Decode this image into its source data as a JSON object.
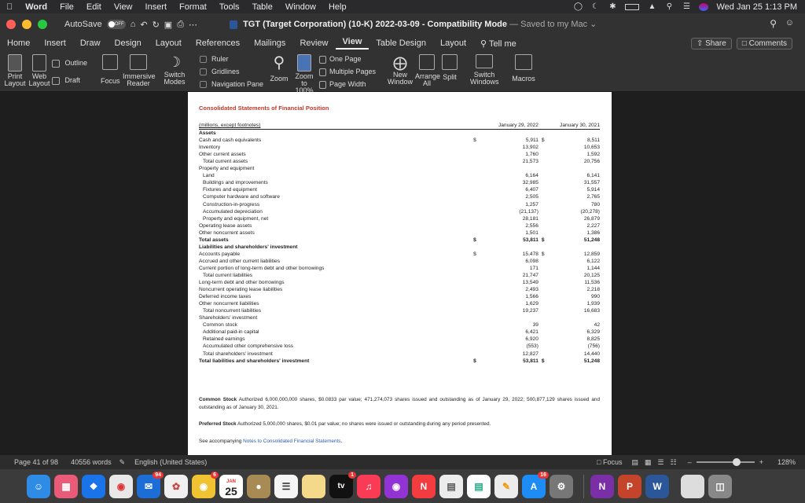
{
  "menubar": {
    "apple_icon": "apple-icon",
    "items": [
      "Word",
      "File",
      "Edit",
      "View",
      "Insert",
      "Format",
      "Tools",
      "Table",
      "Window",
      "Help"
    ],
    "datetime": "Wed Jan 25  1:13 PM"
  },
  "titlebar": {
    "autosave_label": "AutoSave",
    "autosave_state": "OFF",
    "doc_title": "TGT (Target Corporation) (10-K) 2022-03-09  -  Compatibility Mode",
    "saved_status": "— Saved to my Mac ⌄"
  },
  "tabs": {
    "items": [
      "Home",
      "Insert",
      "Draw",
      "Design",
      "Layout",
      "References",
      "Mailings",
      "Review",
      "View",
      "Table Design",
      "Layout"
    ],
    "active": "View",
    "tell_me": "Tell me",
    "share": "Share",
    "comments": "Comments"
  },
  "ribbon": {
    "print_layout": "Print\nLayout",
    "web_layout": "Web\nLayout",
    "outline": "Outline",
    "draft": "Draft",
    "focus": "Focus",
    "immersive_reader": "Immersive\nReader",
    "switch_modes": "Switch\nModes",
    "ruler": "Ruler",
    "gridlines": "Gridlines",
    "navigation_pane": "Navigation Pane",
    "zoom": "Zoom",
    "zoom_100": "Zoom\nto 100%",
    "one_page": "One Page",
    "multiple_pages": "Multiple Pages",
    "page_width": "Page Width",
    "new_window": "New\nWindow",
    "arrange_all": "Arrange\nAll",
    "split": "Split",
    "switch_windows": "Switch\nWindows",
    "macros": "Macros"
  },
  "document": {
    "heading": "Consolidated Statements of Financial Position",
    "col_header_label": "(millions, except footnotes)",
    "col1": "January 29, 2022",
    "col2": "January 30, 2021",
    "rows": [
      {
        "label": "Assets",
        "style": "bold"
      },
      {
        "label": "Cash and cash equivalents",
        "c1": "$",
        "v1": "5,911",
        "c2": "$",
        "v2": "8,511"
      },
      {
        "label": "Inventory",
        "v1": "13,902",
        "v2": "10,653"
      },
      {
        "label": "Other current assets",
        "v1": "1,760",
        "v2": "1,592"
      },
      {
        "label": "Total current assets",
        "v1": "21,573",
        "v2": "20,756",
        "style": "indent"
      },
      {
        "label": "Property and equipment"
      },
      {
        "label": "Land",
        "v1": "6,164",
        "v2": "6,141",
        "style": "indent"
      },
      {
        "label": "Buildings and improvements",
        "v1": "32,985",
        "v2": "31,557",
        "style": "indent"
      },
      {
        "label": "Fixtures and equipment",
        "v1": "6,407",
        "v2": "5,914",
        "style": "indent"
      },
      {
        "label": "Computer hardware and software",
        "v1": "2,505",
        "v2": "2,765",
        "style": "indent"
      },
      {
        "label": "Construction-in-progress",
        "v1": "1,257",
        "v2": "780",
        "style": "indent"
      },
      {
        "label": "Accumulated depreciation",
        "v1": "(21,137)",
        "v2": "(20,278)",
        "style": "indent"
      },
      {
        "label": "Property and equipment, net",
        "v1": "28,181",
        "v2": "26,879",
        "style": "indent"
      },
      {
        "label": "Operating lease assets",
        "v1": "2,556",
        "v2": "2,227"
      },
      {
        "label": "Other noncurrent assets",
        "v1": "1,501",
        "v2": "1,386"
      },
      {
        "label": "Total assets",
        "c1": "$",
        "v1": "53,811",
        "c2": "$",
        "v2": "51,248",
        "style": "bold"
      },
      {
        "label": "Liabilities and shareholders' investment",
        "style": "bold"
      },
      {
        "label": "Accounts payable",
        "c1": "$",
        "v1": "15,478",
        "c2": "$",
        "v2": "12,859"
      },
      {
        "label": "Accrued and other current liabilities",
        "v1": "6,098",
        "v2": "6,122"
      },
      {
        "label": "Current portion of long-term debt and other borrowings",
        "v1": "171",
        "v2": "1,144"
      },
      {
        "label": "Total current liabilities",
        "v1": "21,747",
        "v2": "20,125",
        "style": "indent"
      },
      {
        "label": "Long-term debt and other borrowings",
        "v1": "13,549",
        "v2": "11,536"
      },
      {
        "label": "Noncurrent operating lease liabilities",
        "v1": "2,493",
        "v2": "2,218"
      },
      {
        "label": "Deferred income taxes",
        "v1": "1,566",
        "v2": "990"
      },
      {
        "label": "Other noncurrent liabilities",
        "v1": "1,629",
        "v2": "1,939"
      },
      {
        "label": "Total noncurrent liabilities",
        "v1": "19,237",
        "v2": "16,683",
        "style": "indent"
      },
      {
        "label": "Shareholders' investment"
      },
      {
        "label": "Common stock",
        "v1": "39",
        "v2": "42",
        "style": "indent"
      },
      {
        "label": "Additional paid-in capital",
        "v1": "6,421",
        "v2": "6,329",
        "style": "indent"
      },
      {
        "label": "Retained earnings",
        "v1": "6,920",
        "v2": "8,825",
        "style": "indent"
      },
      {
        "label": "Accumulated other comprehensive loss",
        "v1": "(553)",
        "v2": "(756)",
        "style": "indent"
      },
      {
        "label": "Total shareholders' investment",
        "v1": "12,827",
        "v2": "14,440",
        "style": "indent"
      },
      {
        "label": "Total liabilities and shareholders' investment",
        "c1": "$",
        "v1": "53,811",
        "c2": "$",
        "v2": "51,248",
        "style": "bold"
      }
    ],
    "common_stock_title": "Common Stock",
    "common_stock_text": "Authorized 6,000,000,000 shares, $0.0833 par value; 471,274,073 shares issued and outstanding as of January 29, 2022; 500,877,129 shares issued and outstanding as of January 30, 2021.",
    "preferred_stock_title": "Preferred Stock",
    "preferred_stock_text": "Authorized 5,000,000 shares, $0.01 par value; no shares were issued or outstanding during any period presented.",
    "see_text": "See accompanying ",
    "see_link": "Notes to Consolidated Financial Statements",
    "see_end": "."
  },
  "status": {
    "page": "Page 41 of 98",
    "words": "40556 words",
    "language": "English (United States)",
    "focus": "Focus",
    "zoom": "128%",
    "minus": "–",
    "plus": "+"
  },
  "dock": {
    "calendar_month": "JAN",
    "calendar_day": "25",
    "appletv": "tv",
    "badge_94": "94",
    "badge_6": "6",
    "badge_1": "1",
    "badge_16": "16"
  }
}
